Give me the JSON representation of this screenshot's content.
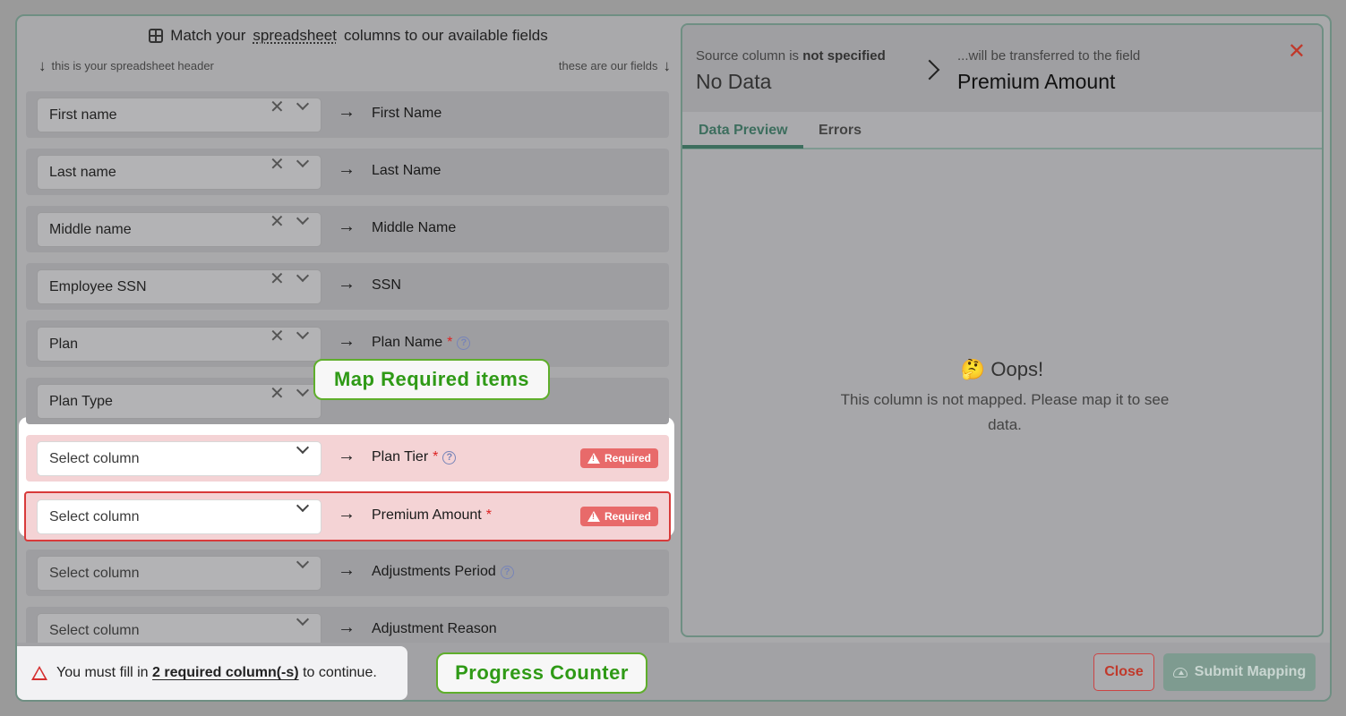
{
  "header": {
    "title_prefix": "Match your",
    "title_link": "spreadsheet",
    "title_suffix": "columns to our available fields",
    "hint_left": "this is your spreadsheet header",
    "hint_right": "these are our fields"
  },
  "rows": [
    {
      "source": "First name",
      "field": "First Name",
      "required": false,
      "help": false
    },
    {
      "source": "Last name",
      "field": "Last Name",
      "required": false,
      "help": false
    },
    {
      "source": "Middle name",
      "field": "Middle Name",
      "required": false,
      "help": false
    },
    {
      "source": "Employee SSN",
      "field": "SSN",
      "required": false,
      "help": false
    },
    {
      "source": "Plan",
      "field": "Plan Name",
      "required": true,
      "help": true
    },
    {
      "source": "Plan Type",
      "field": "",
      "required": false,
      "help": false
    },
    {
      "source": "Select column",
      "field": "Plan Tier",
      "required": true,
      "help": true,
      "badge": "Required"
    },
    {
      "source": "Select column",
      "field": "Premium Amount",
      "required": true,
      "help": false,
      "badge": "Required"
    },
    {
      "source": "Select column",
      "field": "Adjustments Period",
      "required": false,
      "help": true
    },
    {
      "source": "Select column",
      "field": "Adjustment Reason",
      "required": false,
      "help": false
    }
  ],
  "callouts": {
    "map_required": "Map Required items",
    "progress": "Progress Counter"
  },
  "detail": {
    "source_label_prefix": "Source column is",
    "source_label_bold": "not specified",
    "source_value": "No Data",
    "dest_label": "...will be transferred to the field",
    "dest_value": "Premium Amount",
    "close_glyph": "✕",
    "tabs": [
      "Data Preview",
      "Errors"
    ],
    "empty_title": "🤔 Oops!",
    "empty_message": "This column is not mapped. Please map it to see data."
  },
  "footer": {
    "notice_prefix": "You must fill in",
    "notice_count": "2 required column(-s)",
    "notice_suffix": "to continue.",
    "close_label": "Close",
    "submit_label": "Submit Mapping"
  },
  "glyphs": {
    "clear": "✕",
    "arrow": "→",
    "star": "*",
    "help": "?",
    "down": "↓"
  }
}
